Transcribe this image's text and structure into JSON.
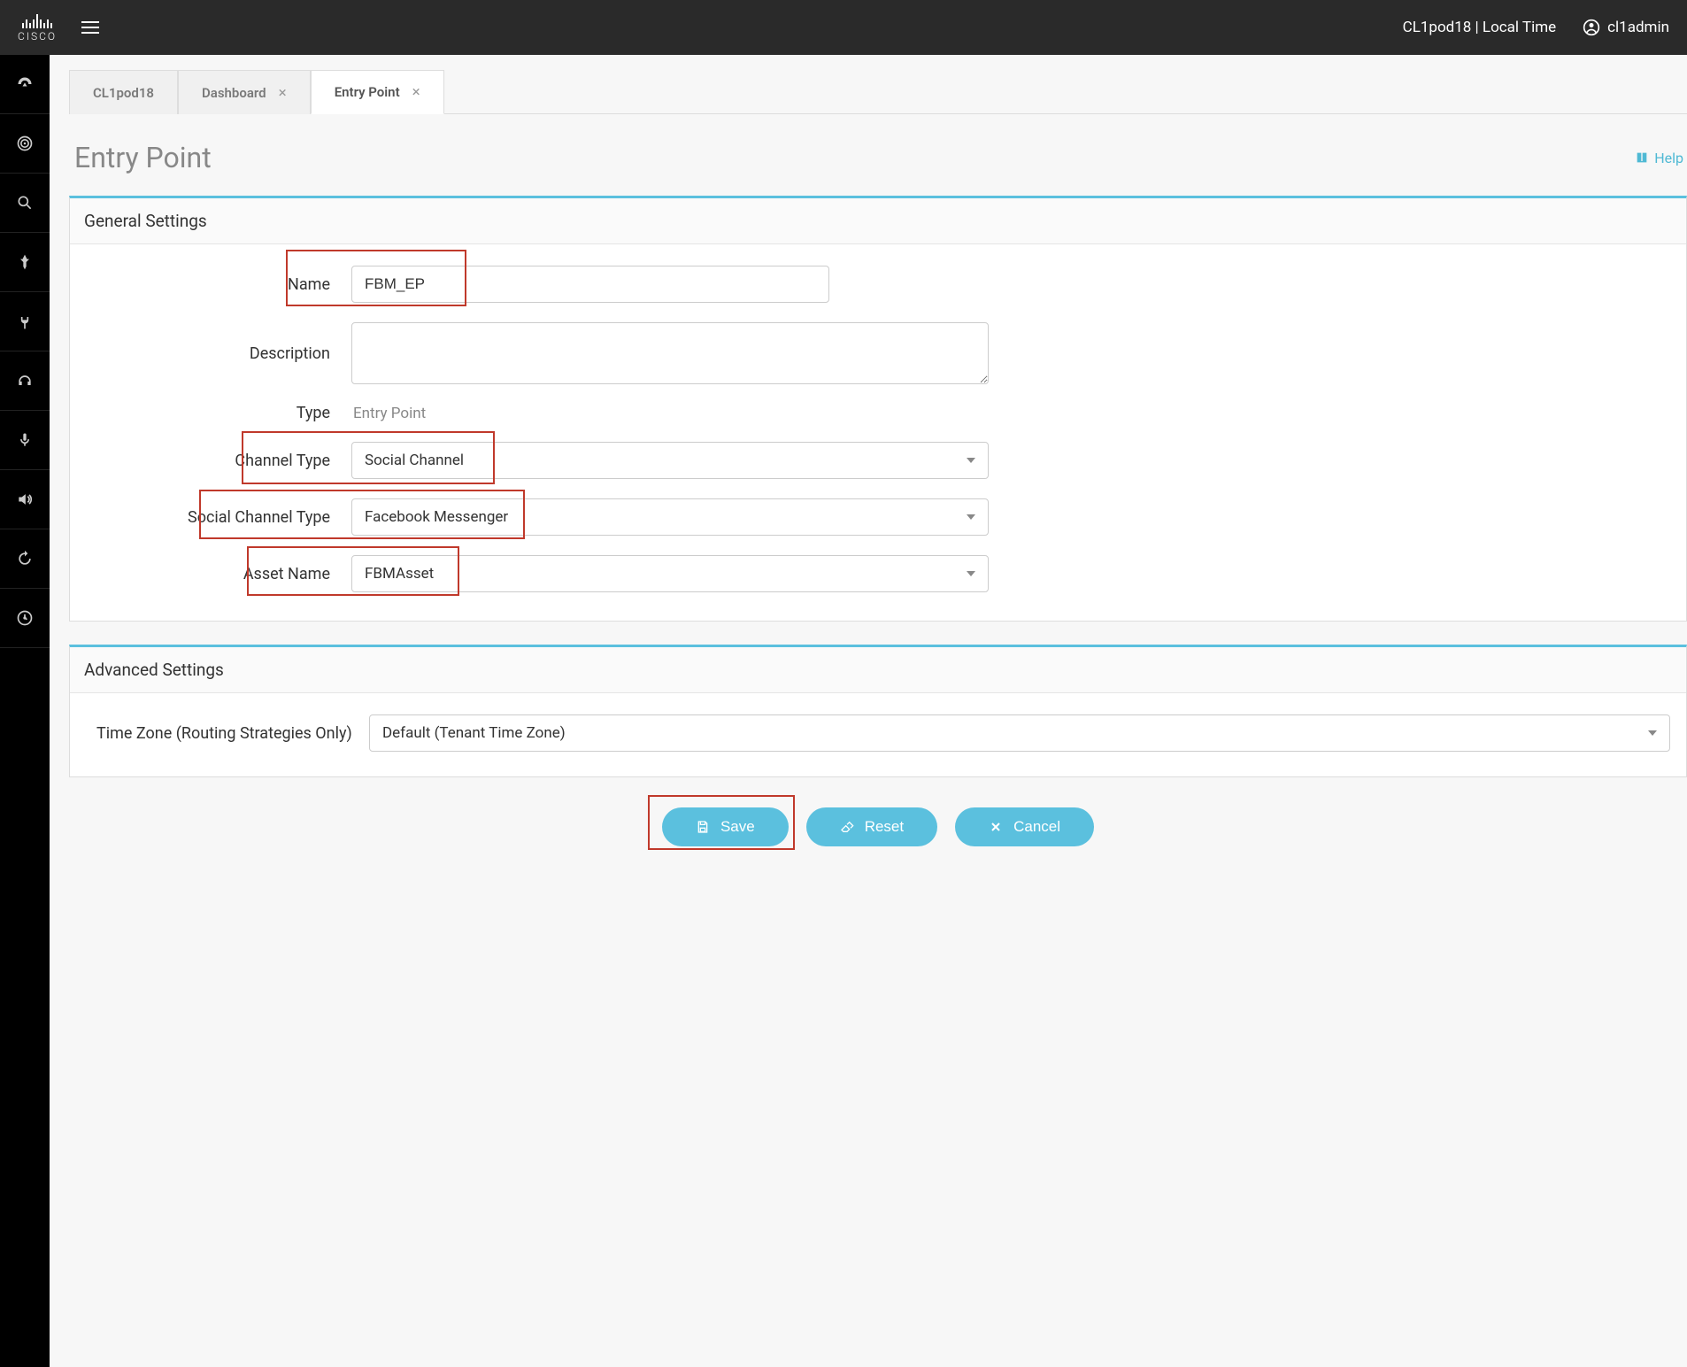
{
  "header": {
    "tenant_time": "CL1pod18 | Local Time",
    "username": "cl1admin",
    "brand": "cisco"
  },
  "tabs": [
    {
      "label": "CL1pod18",
      "closable": false
    },
    {
      "label": "Dashboard",
      "closable": true
    },
    {
      "label": "Entry Point",
      "closable": true,
      "active": true
    }
  ],
  "page": {
    "title": "Entry Point",
    "help_label": "Help"
  },
  "general_settings": {
    "panel_title": "General Settings",
    "name_label": "Name",
    "name_value": "FBM_EP",
    "description_label": "Description",
    "description_value": "",
    "type_label": "Type",
    "type_value": "Entry Point",
    "channel_type_label": "Channel Type",
    "channel_type_value": "Social Channel",
    "social_channel_type_label": "Social Channel Type",
    "social_channel_type_value": "Facebook Messenger",
    "asset_name_label": "Asset Name",
    "asset_name_value": "FBMAsset"
  },
  "advanced_settings": {
    "panel_title": "Advanced Settings",
    "timezone_label": "Time Zone (Routing Strategies Only)",
    "timezone_value": "Default (Tenant Time Zone)"
  },
  "actions": {
    "save": "Save",
    "reset": "Reset",
    "cancel": "Cancel"
  }
}
